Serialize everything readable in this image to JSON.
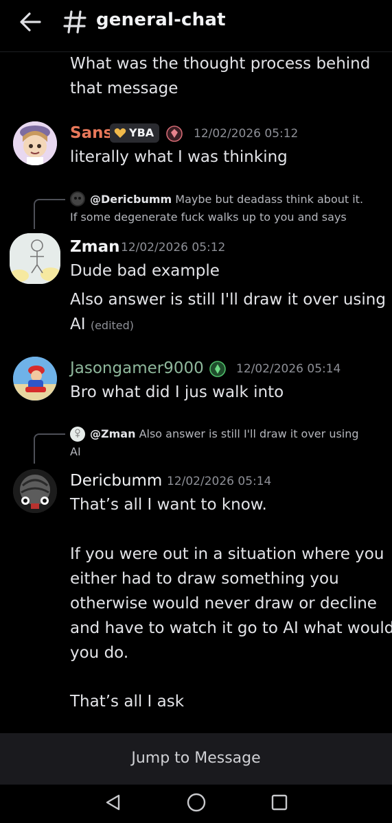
{
  "header": {
    "title": "general-chat"
  },
  "messages": {
    "continuation": {
      "line1": "What was the thought process behind",
      "line2": "that message"
    },
    "sans": {
      "username": "Sans",
      "tag": "YBA",
      "timestamp": "12/02/2026 05:12",
      "text": "literally what I was thinking",
      "name_color": "#e8785a"
    },
    "zman": {
      "reply_name": "@Dericbumm",
      "reply_line1": "Maybe but deadass think about it.",
      "reply_line2": "If some degenerate fuck walks up to you and says",
      "username": "Zman",
      "timestamp": "12/02/2026 05:12",
      "line1": "Dude bad example",
      "line2": "Also answer is still I'll draw it over using",
      "line3": "AI",
      "edited": "(edited)"
    },
    "jason": {
      "username": "Jasongamer9000",
      "timestamp": "12/02/2026 05:14",
      "text": "Bro what did I jus walk into",
      "name_color": "#8fb89c"
    },
    "deric": {
      "reply_name": "@Zman",
      "reply_line1": "Also answer is still I'll draw it over using",
      "reply_line2": "AI",
      "username": "Dericbumm",
      "timestamp": "12/02/2026 05:14",
      "line1": "That’s all I want to know.",
      "line2": "If you were out in a situation where you",
      "line3": "either had to draw something you",
      "line4": "otherwise would never draw or decline",
      "line5": "and have to watch it go to AI what would",
      "line6": "you do.",
      "line7": "That’s all I ask"
    }
  },
  "jump_bar": {
    "label": "Jump to Message"
  },
  "icons": {
    "back": "back-arrow-icon",
    "channel": "hashtag-icon",
    "tag_badge": "heart-icon",
    "role_badge": "gem-icon",
    "green_badge": "leaf-icon",
    "nav_back": "triangle-back-icon",
    "nav_home": "circle-home-icon",
    "nav_recents": "square-recents-icon"
  }
}
